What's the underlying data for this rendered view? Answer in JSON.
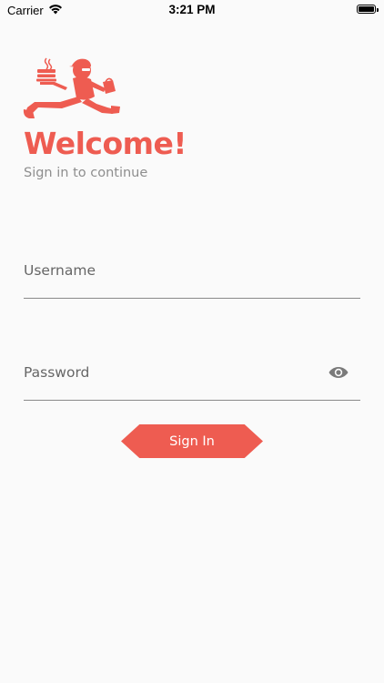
{
  "status_bar": {
    "carrier": "Carrier",
    "time": "3:21 PM",
    "wifi_icon": "wifi-icon",
    "battery_icon": "battery-icon"
  },
  "logo": {
    "icon": "delivery-runner-cake-logo",
    "color": "#ee5c51"
  },
  "header": {
    "title": "Welcome!",
    "subtitle": "Sign in to continue"
  },
  "form": {
    "username_placeholder": "Username",
    "username_value": "",
    "password_placeholder": "Password",
    "password_value": "",
    "password_toggle_icon": "eye-icon",
    "submit_label": "Sign In"
  },
  "colors": {
    "accent": "#ee5c51",
    "background": "#fafafa",
    "subtitle": "#8e8e8e",
    "underline": "#8a8a8a"
  }
}
